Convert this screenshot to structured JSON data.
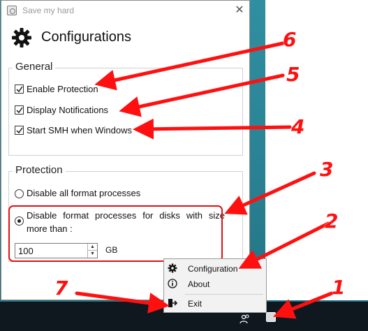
{
  "window": {
    "title": "Save my hard",
    "close_glyph": "✕",
    "heading": "Configurations"
  },
  "general": {
    "legend": "General",
    "options": [
      {
        "label": "Enable Protection",
        "checked": true
      },
      {
        "label": "Display Notifications",
        "checked": true
      },
      {
        "label": "Start SMH when Windows",
        "checked": true
      }
    ]
  },
  "protection": {
    "legend": "Protection",
    "radio_all": {
      "label": "Disable all format processes",
      "selected": false
    },
    "radio_size": {
      "label": "Disable format processes for disks with size more than :",
      "selected": true
    },
    "size_value": "100",
    "unit": "GB"
  },
  "context_menu": {
    "items": [
      {
        "label": "Configuration",
        "icon": "gear-icon"
      },
      {
        "label": "About",
        "icon": "info-icon"
      },
      {
        "label": "Exit",
        "icon": "exit-icon"
      }
    ]
  },
  "annotations": {
    "numbers": [
      "1",
      "2",
      "3",
      "4",
      "5",
      "6",
      "7"
    ],
    "color": "#ff1010"
  },
  "colors": {
    "annotation_red": "#e01010",
    "taskbar": "#10181f",
    "desktop_teal": "#2a8496"
  }
}
